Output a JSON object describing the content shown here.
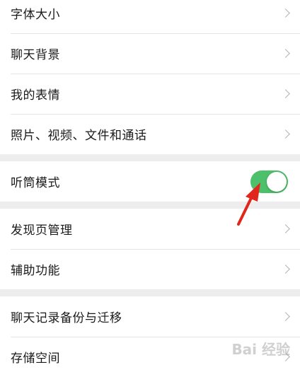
{
  "colors": {
    "toggle_on": "#4dc06b",
    "annotation_arrow": "#e1261c"
  },
  "settings": {
    "group1": [
      {
        "id": "font-size",
        "label": "字体大小"
      },
      {
        "id": "chat-background",
        "label": "聊天背景"
      },
      {
        "id": "my-stickers",
        "label": "我的表情"
      },
      {
        "id": "photos-videos-files-calls",
        "label": "照片、视频、文件和通话"
      }
    ],
    "group2": [
      {
        "id": "receiver-mode",
        "label": "听筒模式",
        "toggle": true,
        "value": true
      }
    ],
    "group3": [
      {
        "id": "discover-manage",
        "label": "发现页管理"
      },
      {
        "id": "accessibility",
        "label": "辅助功能"
      }
    ],
    "group4": [
      {
        "id": "chat-backup-migrate",
        "label": "聊天记录备份与迁移"
      },
      {
        "id": "storage",
        "label": "存储空间"
      }
    ]
  },
  "watermark": {
    "text": "Bai 经验"
  }
}
